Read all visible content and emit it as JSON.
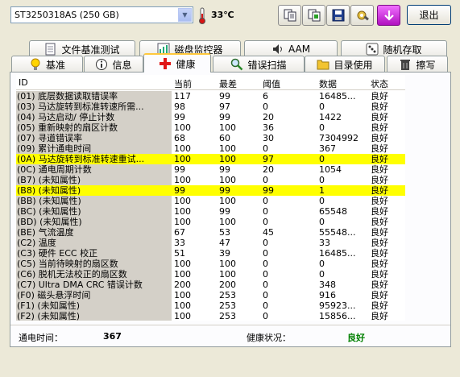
{
  "toolbar": {
    "drive": "ST3250318AS (250 GB)",
    "temperature": "33℃",
    "exit_label": "退出",
    "icons": [
      "copy-icon",
      "copy-all-icon",
      "save-icon",
      "wrench-icon",
      "download-icon"
    ]
  },
  "tabs_row1": [
    {
      "label": "文件基准测试",
      "icon": "document-icon"
    },
    {
      "label": "磁盘监控器",
      "icon": "chart-icon"
    },
    {
      "label": "AAM",
      "icon": "speaker-icon"
    },
    {
      "label": "随机存取",
      "icon": "dice-icon"
    }
  ],
  "tabs_row2": [
    {
      "label": "基准",
      "icon": "lightbulb-icon"
    },
    {
      "label": "信息",
      "icon": "info-icon"
    },
    {
      "label": "健康",
      "icon": "health-cross-icon",
      "active": true
    },
    {
      "label": "错误扫描",
      "icon": "magnifier-icon"
    },
    {
      "label": "目录使用",
      "icon": "folder-icon"
    },
    {
      "label": "擦写",
      "icon": "trash-icon"
    }
  ],
  "table": {
    "columns": [
      "ID",
      "当前",
      "最差",
      "阈值",
      "数据",
      "状态"
    ],
    "rows": [
      {
        "id": "(01) 底层数据读取错误率",
        "current": "117",
        "worst": "99",
        "threshold": "6",
        "data": "16485...",
        "status": "良好"
      },
      {
        "id": "(03) 马达旋转到标准转速所需...",
        "current": "98",
        "worst": "97",
        "threshold": "0",
        "data": "0",
        "status": "良好"
      },
      {
        "id": "(04) 马达启动/ 停止计数",
        "current": "99",
        "worst": "99",
        "threshold": "20",
        "data": "1422",
        "status": "良好"
      },
      {
        "id": "(05) 重新映射的扇区计数",
        "current": "100",
        "worst": "100",
        "threshold": "36",
        "data": "0",
        "status": "良好"
      },
      {
        "id": "(07) 寻道错误率",
        "current": "68",
        "worst": "60",
        "threshold": "30",
        "data": "7304992",
        "status": "良好"
      },
      {
        "id": "(09) 累计通电时间",
        "current": "100",
        "worst": "100",
        "threshold": "0",
        "data": "367",
        "status": "良好"
      },
      {
        "id": "(0A) 马达旋转到标准转速重试...",
        "current": "100",
        "worst": "100",
        "threshold": "97",
        "data": "0",
        "status": "良好",
        "highlight": true
      },
      {
        "id": "(0C) 通电周期计数",
        "current": "99",
        "worst": "99",
        "threshold": "20",
        "data": "1054",
        "status": "良好"
      },
      {
        "id": "(B7) (未知属性)",
        "current": "100",
        "worst": "100",
        "threshold": "0",
        "data": "0",
        "status": "良好"
      },
      {
        "id": "(B8) (未知属性)",
        "current": "99",
        "worst": "99",
        "threshold": "99",
        "data": "1",
        "status": "良好",
        "highlight": true
      },
      {
        "id": "(BB) (未知属性)",
        "current": "100",
        "worst": "100",
        "threshold": "0",
        "data": "0",
        "status": "良好"
      },
      {
        "id": "(BC) (未知属性)",
        "current": "100",
        "worst": "99",
        "threshold": "0",
        "data": "65548",
        "status": "良好"
      },
      {
        "id": "(BD) (未知属性)",
        "current": "100",
        "worst": "100",
        "threshold": "0",
        "data": "0",
        "status": "良好"
      },
      {
        "id": "(BE) 气流温度",
        "current": "67",
        "worst": "53",
        "threshold": "45",
        "data": "55548...",
        "status": "良好"
      },
      {
        "id": "(C2) 温度",
        "current": "33",
        "worst": "47",
        "threshold": "0",
        "data": "33",
        "status": "良好"
      },
      {
        "id": "(C3) 硬件 ECC 校正",
        "current": "51",
        "worst": "39",
        "threshold": "0",
        "data": "16485...",
        "status": "良好"
      },
      {
        "id": "(C5) 当前待映射的扇区数",
        "current": "100",
        "worst": "100",
        "threshold": "0",
        "data": "0",
        "status": "良好"
      },
      {
        "id": "(C6) 脱机无法校正的扇区数",
        "current": "100",
        "worst": "100",
        "threshold": "0",
        "data": "0",
        "status": "良好"
      },
      {
        "id": "(C7) Ultra DMA CRC 错误计数",
        "current": "200",
        "worst": "200",
        "threshold": "0",
        "data": "348",
        "status": "良好"
      },
      {
        "id": "(F0) 磁头悬浮时间",
        "current": "100",
        "worst": "253",
        "threshold": "0",
        "data": "916",
        "status": "良好"
      },
      {
        "id": "(F1) (未知属性)",
        "current": "100",
        "worst": "253",
        "threshold": "0",
        "data": "95923...",
        "status": "良好"
      },
      {
        "id": "(F2) (未知属性)",
        "current": "100",
        "worst": "253",
        "threshold": "0",
        "data": "15856...",
        "status": "良好"
      }
    ]
  },
  "footer": {
    "power_on_label": "通电时间：",
    "power_on_value": "367",
    "health_label": "健康状况：",
    "health_value": "良好"
  },
  "colors": {
    "highlight": "#ffff00",
    "health_good": "#008000",
    "exit_border": "#003c74",
    "download_button": "#c81ed2"
  }
}
